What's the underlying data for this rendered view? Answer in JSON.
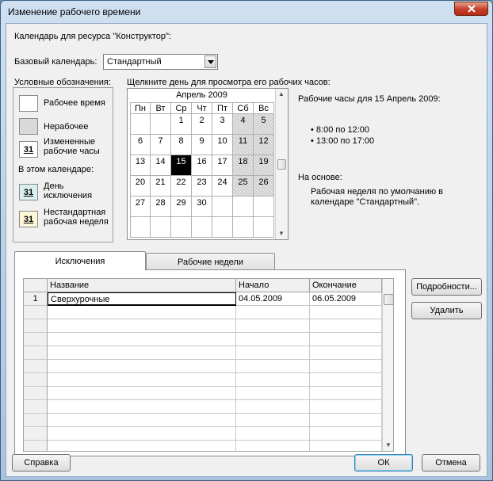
{
  "window": {
    "title": "Изменение рабочего времени"
  },
  "resource_calendar_label": "Календарь для ресурса \"Конструктор\":",
  "base_calendar": {
    "label": "Базовый календарь:",
    "value": "Стандартный"
  },
  "legend": {
    "heading": "Условные обозначения:",
    "working": "Рабочее время",
    "nonworking": "Нерабочее",
    "changed": "Измененные рабочие часы",
    "in_this_calendar": "В этом календаре:",
    "exception": "День исключения",
    "nonstandard": "Нестандартная рабочая неделя",
    "swatch_number": "31"
  },
  "calendar": {
    "instruction": "Щелкните день для просмотра его рабочих часов:",
    "month": "Апрель 2009",
    "weekdays": [
      "Пн",
      "Вт",
      "Ср",
      "Чт",
      "Пт",
      "Сб",
      "Вс"
    ],
    "weeks": [
      [
        "",
        "",
        "1",
        "2",
        "3",
        "4",
        "5"
      ],
      [
        "6",
        "7",
        "8",
        "9",
        "10",
        "11",
        "12"
      ],
      [
        "13",
        "14",
        "15",
        "16",
        "17",
        "18",
        "19"
      ],
      [
        "20",
        "21",
        "22",
        "23",
        "24",
        "25",
        "26"
      ],
      [
        "27",
        "28",
        "29",
        "30",
        "",
        "",
        ""
      ],
      [
        "",
        "",
        "",
        "",
        "",
        "",
        ""
      ]
    ],
    "selected_day": "15"
  },
  "working_hours": {
    "heading": "Рабочие часы для 15 Апрель 2009:",
    "ranges": [
      "8:00 по 12:00",
      "13:00 по 17:00"
    ],
    "based_on_label": "На основе:",
    "based_on_text": "Рабочая неделя по умолчанию в календаре \"Стандартный\"."
  },
  "tabs": {
    "exceptions": "Исключения",
    "work_weeks": "Рабочие недели"
  },
  "table": {
    "columns": [
      "Название",
      "Начало",
      "Окончание"
    ],
    "rows": [
      {
        "num": "1",
        "name": "Сверхурочные",
        "start": "04.05.2009",
        "end": "06.05.2009"
      }
    ]
  },
  "buttons": {
    "details": "Подробности...",
    "delete": "Удалить",
    "help": "Справка",
    "ok": "ОК",
    "cancel": "Отмена"
  },
  "colors": {
    "selected_day_bg": "#000000",
    "exception_swatch": "#d9f0ef",
    "nonstandard_swatch": "#fdf6d8"
  }
}
